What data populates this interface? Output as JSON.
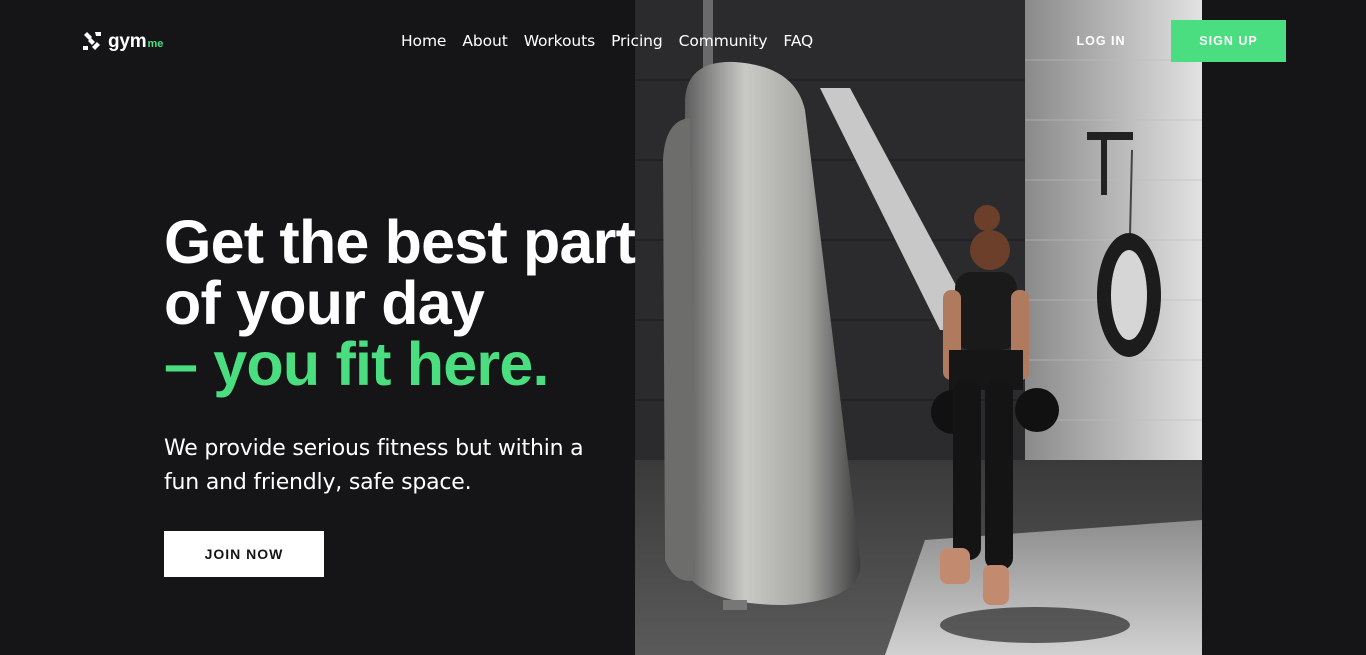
{
  "brand": {
    "name": "gym",
    "suffix": "me",
    "logo_icon": "gymme-logo-icon",
    "accent_color": "#4ade80",
    "background_color": "#151517"
  },
  "nav": {
    "items": [
      {
        "label": "Home"
      },
      {
        "label": "About"
      },
      {
        "label": "Workouts"
      },
      {
        "label": "Pricing"
      },
      {
        "label": "Community"
      },
      {
        "label": "FAQ"
      }
    ]
  },
  "auth": {
    "login_label": "LOG IN",
    "signup_label": "SIGN UP"
  },
  "hero": {
    "headline_line1": "Get the best part",
    "headline_line2": "of your day",
    "headline_accent": "– you fit here.",
    "subtext": "We provide serious fitness but within a fun and friendly, safe space.",
    "cta_label": "JOIN NOW",
    "image": "woman-boxing-next-to-punching-bag-photo"
  }
}
